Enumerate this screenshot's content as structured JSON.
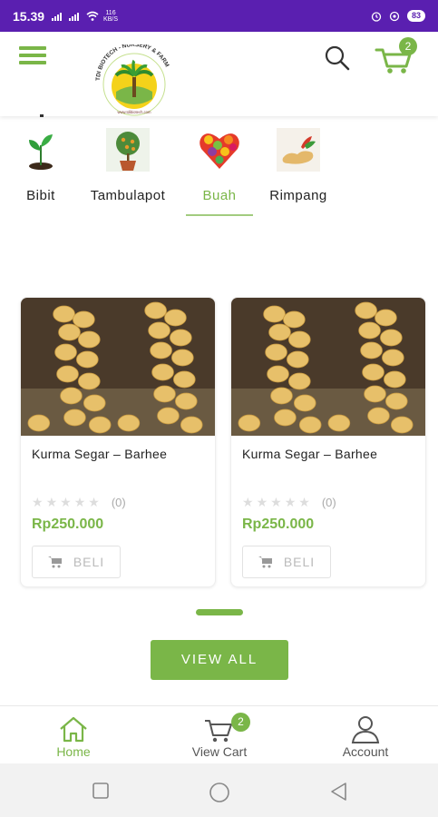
{
  "status_bar": {
    "time": "15.39",
    "speed_value": "116",
    "speed_unit": "KB/S",
    "battery": "83",
    "signal_icons": [
      "signal-icon",
      "signal-icon",
      "wifi-icon"
    ],
    "right_icons": [
      "alarm-icon",
      "sync-icon"
    ]
  },
  "header": {
    "menu_icon": "hamburger-menu-icon",
    "logo_text": "TDI BIOTECH - NURSERY & FARM",
    "logo_url": "www.tdibiotech.com",
    "search_icon": "search-icon",
    "cart_icon": "cart-icon",
    "cart_count": "2"
  },
  "categories": [
    {
      "label": "Bibit",
      "icon": "seedling-icon",
      "active": false
    },
    {
      "label": "Tambulapot",
      "icon": "potted-tree-icon",
      "active": false
    },
    {
      "label": "Buah",
      "icon": "fruit-heart-icon",
      "active": true
    },
    {
      "label": "Rimpang",
      "icon": "rhizome-icon",
      "active": false
    }
  ],
  "products": [
    {
      "title": "Kurma Segar – Barhee",
      "rating_count": "(0)",
      "stars": 0,
      "price": "Rp250.000",
      "buy_label": "BELI"
    },
    {
      "title": "Kurma Segar – Barhee",
      "rating_count": "(0)",
      "stars": 0,
      "price": "Rp250.000",
      "buy_label": "BELI"
    }
  ],
  "view_all_label": "VIEW ALL",
  "bottom_nav": {
    "items": [
      {
        "label": "Home",
        "icon": "home-icon",
        "active": true
      },
      {
        "label": "View Cart",
        "icon": "cart-icon",
        "active": false
      },
      {
        "label": "Account",
        "icon": "user-icon",
        "active": false
      }
    ],
    "cart_badge": "2"
  },
  "system_nav": [
    "recents-icon",
    "home-circle-icon",
    "back-icon"
  ],
  "colors": {
    "status_bar": "#5a1fb0",
    "accent": "#7ab648",
    "text": "#222222"
  }
}
